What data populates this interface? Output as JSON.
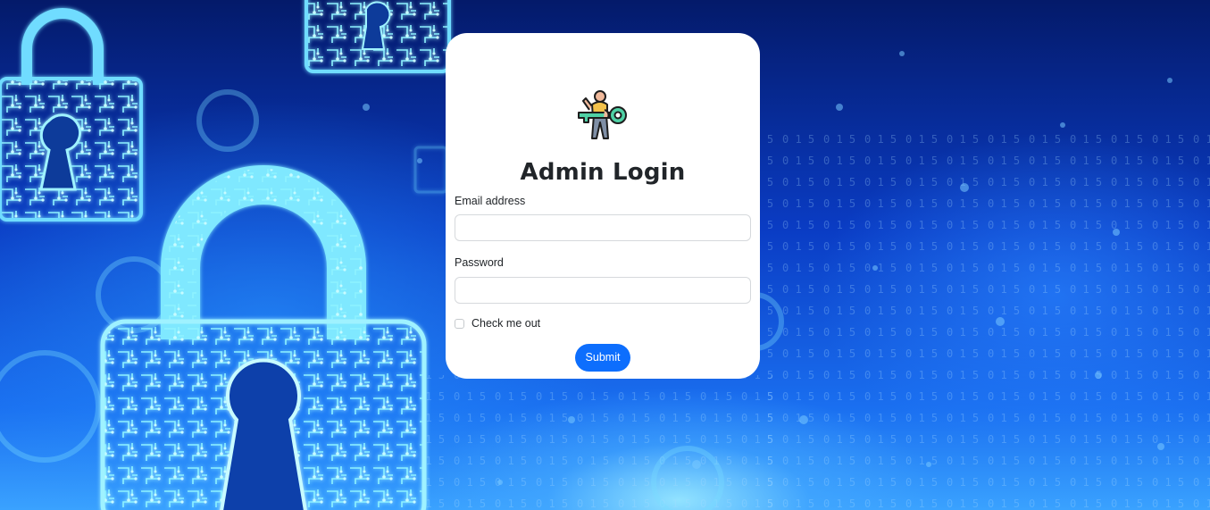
{
  "page": {
    "title": "Admin Login"
  },
  "form": {
    "email_label": "Email address",
    "email_value": "",
    "password_label": "Password",
    "password_value": "",
    "remember_label": "Check me out",
    "remember_checked": false,
    "submit_label": "Submit"
  },
  "icons": {
    "logo": "person-with-key-icon",
    "background": "digital-padlock-circuit-illustration"
  },
  "colors": {
    "primary": "#0d6efd",
    "card": "#ffffff",
    "text": "#212529",
    "background_dark": "#041a6a",
    "background_light": "#3aa2ff",
    "circuit": "#7fe8ff"
  }
}
